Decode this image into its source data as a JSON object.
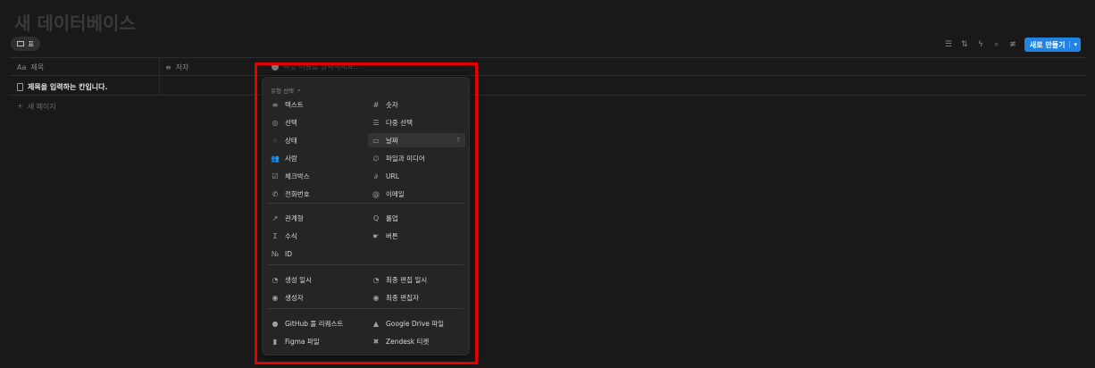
{
  "page": {
    "title": "새 데이터베이스"
  },
  "view_tab": {
    "label": "표"
  },
  "toolbar": {
    "new_label": "새로 만들기",
    "accent": "#2383e2"
  },
  "table": {
    "columns": [
      {
        "icon": "Aa",
        "label": "제목"
      },
      {
        "icon": "≡",
        "label": "저자"
      }
    ],
    "row_title": "제목을 입력하는 칸입니다.",
    "new_page": "새 페이지"
  },
  "property_input": {
    "placeholder": "속성 이름을 입력하세요..."
  },
  "menu": {
    "label": "유형 선택",
    "left": [
      {
        "icon": "≡",
        "label": "텍스트"
      },
      {
        "icon": "◎",
        "label": "선택"
      },
      {
        "icon": "⁘",
        "label": "상태"
      },
      {
        "icon": "👥",
        "label": "사람"
      },
      {
        "icon": "☑",
        "label": "체크박스"
      },
      {
        "icon": "✆",
        "label": "전화번호"
      },
      {
        "icon": "↗",
        "label": "관계형"
      },
      {
        "icon": "Σ",
        "label": "수식"
      },
      {
        "icon": "№",
        "label": "ID"
      },
      {
        "icon": "◔",
        "label": "생성 일시"
      },
      {
        "icon": "◉",
        "label": "생성자"
      },
      {
        "icon": "●",
        "label": "GitHub 풀 리퀘스트"
      },
      {
        "icon": "▮",
        "label": "Figma 파일"
      }
    ],
    "right": [
      {
        "icon": "#",
        "label": "숫자"
      },
      {
        "icon": "☰",
        "label": "다중 선택"
      },
      {
        "icon": "▭",
        "label": "날짜"
      },
      {
        "icon": "∅",
        "label": "파일과 미디어"
      },
      {
        "icon": "∂",
        "label": "URL"
      },
      {
        "icon": "@",
        "label": "이메일"
      },
      {
        "icon": "Q",
        "label": "롤업"
      },
      {
        "icon": "☛",
        "label": "버튼"
      },
      {
        "icon": "◔",
        "label": "최종 편집 일시"
      },
      {
        "icon": "◉",
        "label": "최종 편집자"
      },
      {
        "icon": "▲",
        "label": "Google Drive 파일"
      },
      {
        "icon": "✖",
        "label": "Zendesk 티켓"
      }
    ]
  }
}
